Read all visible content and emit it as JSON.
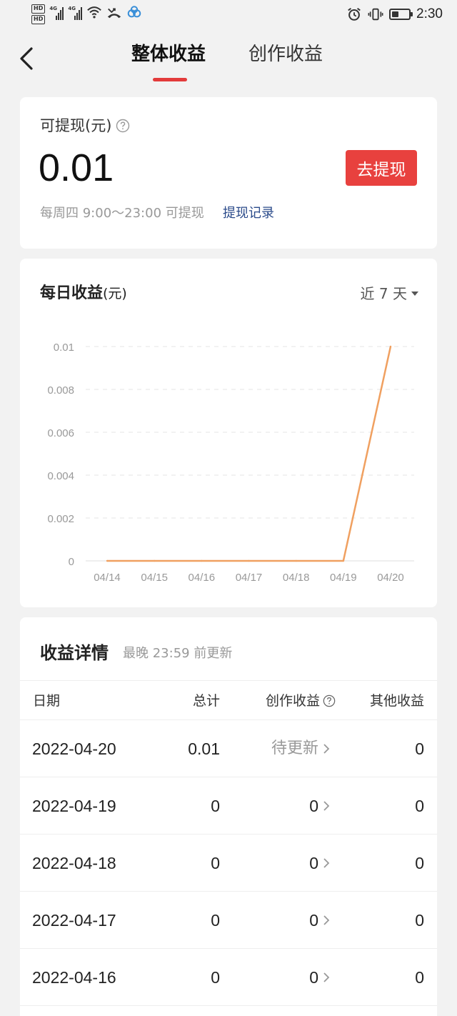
{
  "status_bar": {
    "sim1": "HD",
    "sim2": "HD",
    "net1": "4G",
    "net2": "4G",
    "time": "2:30",
    "icons": [
      "wifi-icon",
      "missed-call-icon",
      "cloud-app-icon",
      "alarm-icon",
      "vibrate-icon",
      "battery-icon"
    ],
    "battery_level": 0.4
  },
  "nav": {
    "tabs": [
      {
        "label": "整体收益",
        "active": true
      },
      {
        "label": "创作收益",
        "active": false
      }
    ],
    "accent": "#e33b3b"
  },
  "withdraw": {
    "label": "可提现(元)",
    "amount": "0.01",
    "button": "去提现",
    "schedule": "每周四 9:00～23:00 可提现",
    "record_link": "提现记录",
    "button_color": "#e8413e"
  },
  "daily": {
    "title": "每日收益",
    "unit": "(元)",
    "range": "近 7 天"
  },
  "chart_data": {
    "type": "line",
    "categories": [
      "04/14",
      "04/15",
      "04/16",
      "04/17",
      "04/18",
      "04/19",
      "04/20"
    ],
    "series": [
      {
        "values": [
          0,
          0,
          0,
          0,
          0,
          0,
          0.01
        ],
        "color": "#f0a060"
      }
    ],
    "ylim": [
      0,
      0.01
    ],
    "yticks": [
      "0",
      "0.002",
      "0.004",
      "0.006",
      "0.008",
      "0.01"
    ],
    "grid": true,
    "title": "",
    "xlabel": "",
    "ylabel": ""
  },
  "detail": {
    "title": "收益详情",
    "subtitle": "最晚 23:59 前更新",
    "columns": [
      "日期",
      "总计",
      "创作收益",
      "其他收益"
    ],
    "rows": [
      {
        "date": "2022-04-20",
        "total": "0.01",
        "creation": "待更新",
        "other": "0"
      },
      {
        "date": "2022-04-19",
        "total": "0",
        "creation": "0",
        "other": "0"
      },
      {
        "date": "2022-04-18",
        "total": "0",
        "creation": "0",
        "other": "0"
      },
      {
        "date": "2022-04-17",
        "total": "0",
        "creation": "0",
        "other": "0"
      },
      {
        "date": "2022-04-16",
        "total": "0",
        "creation": "0",
        "other": "0"
      }
    ]
  }
}
